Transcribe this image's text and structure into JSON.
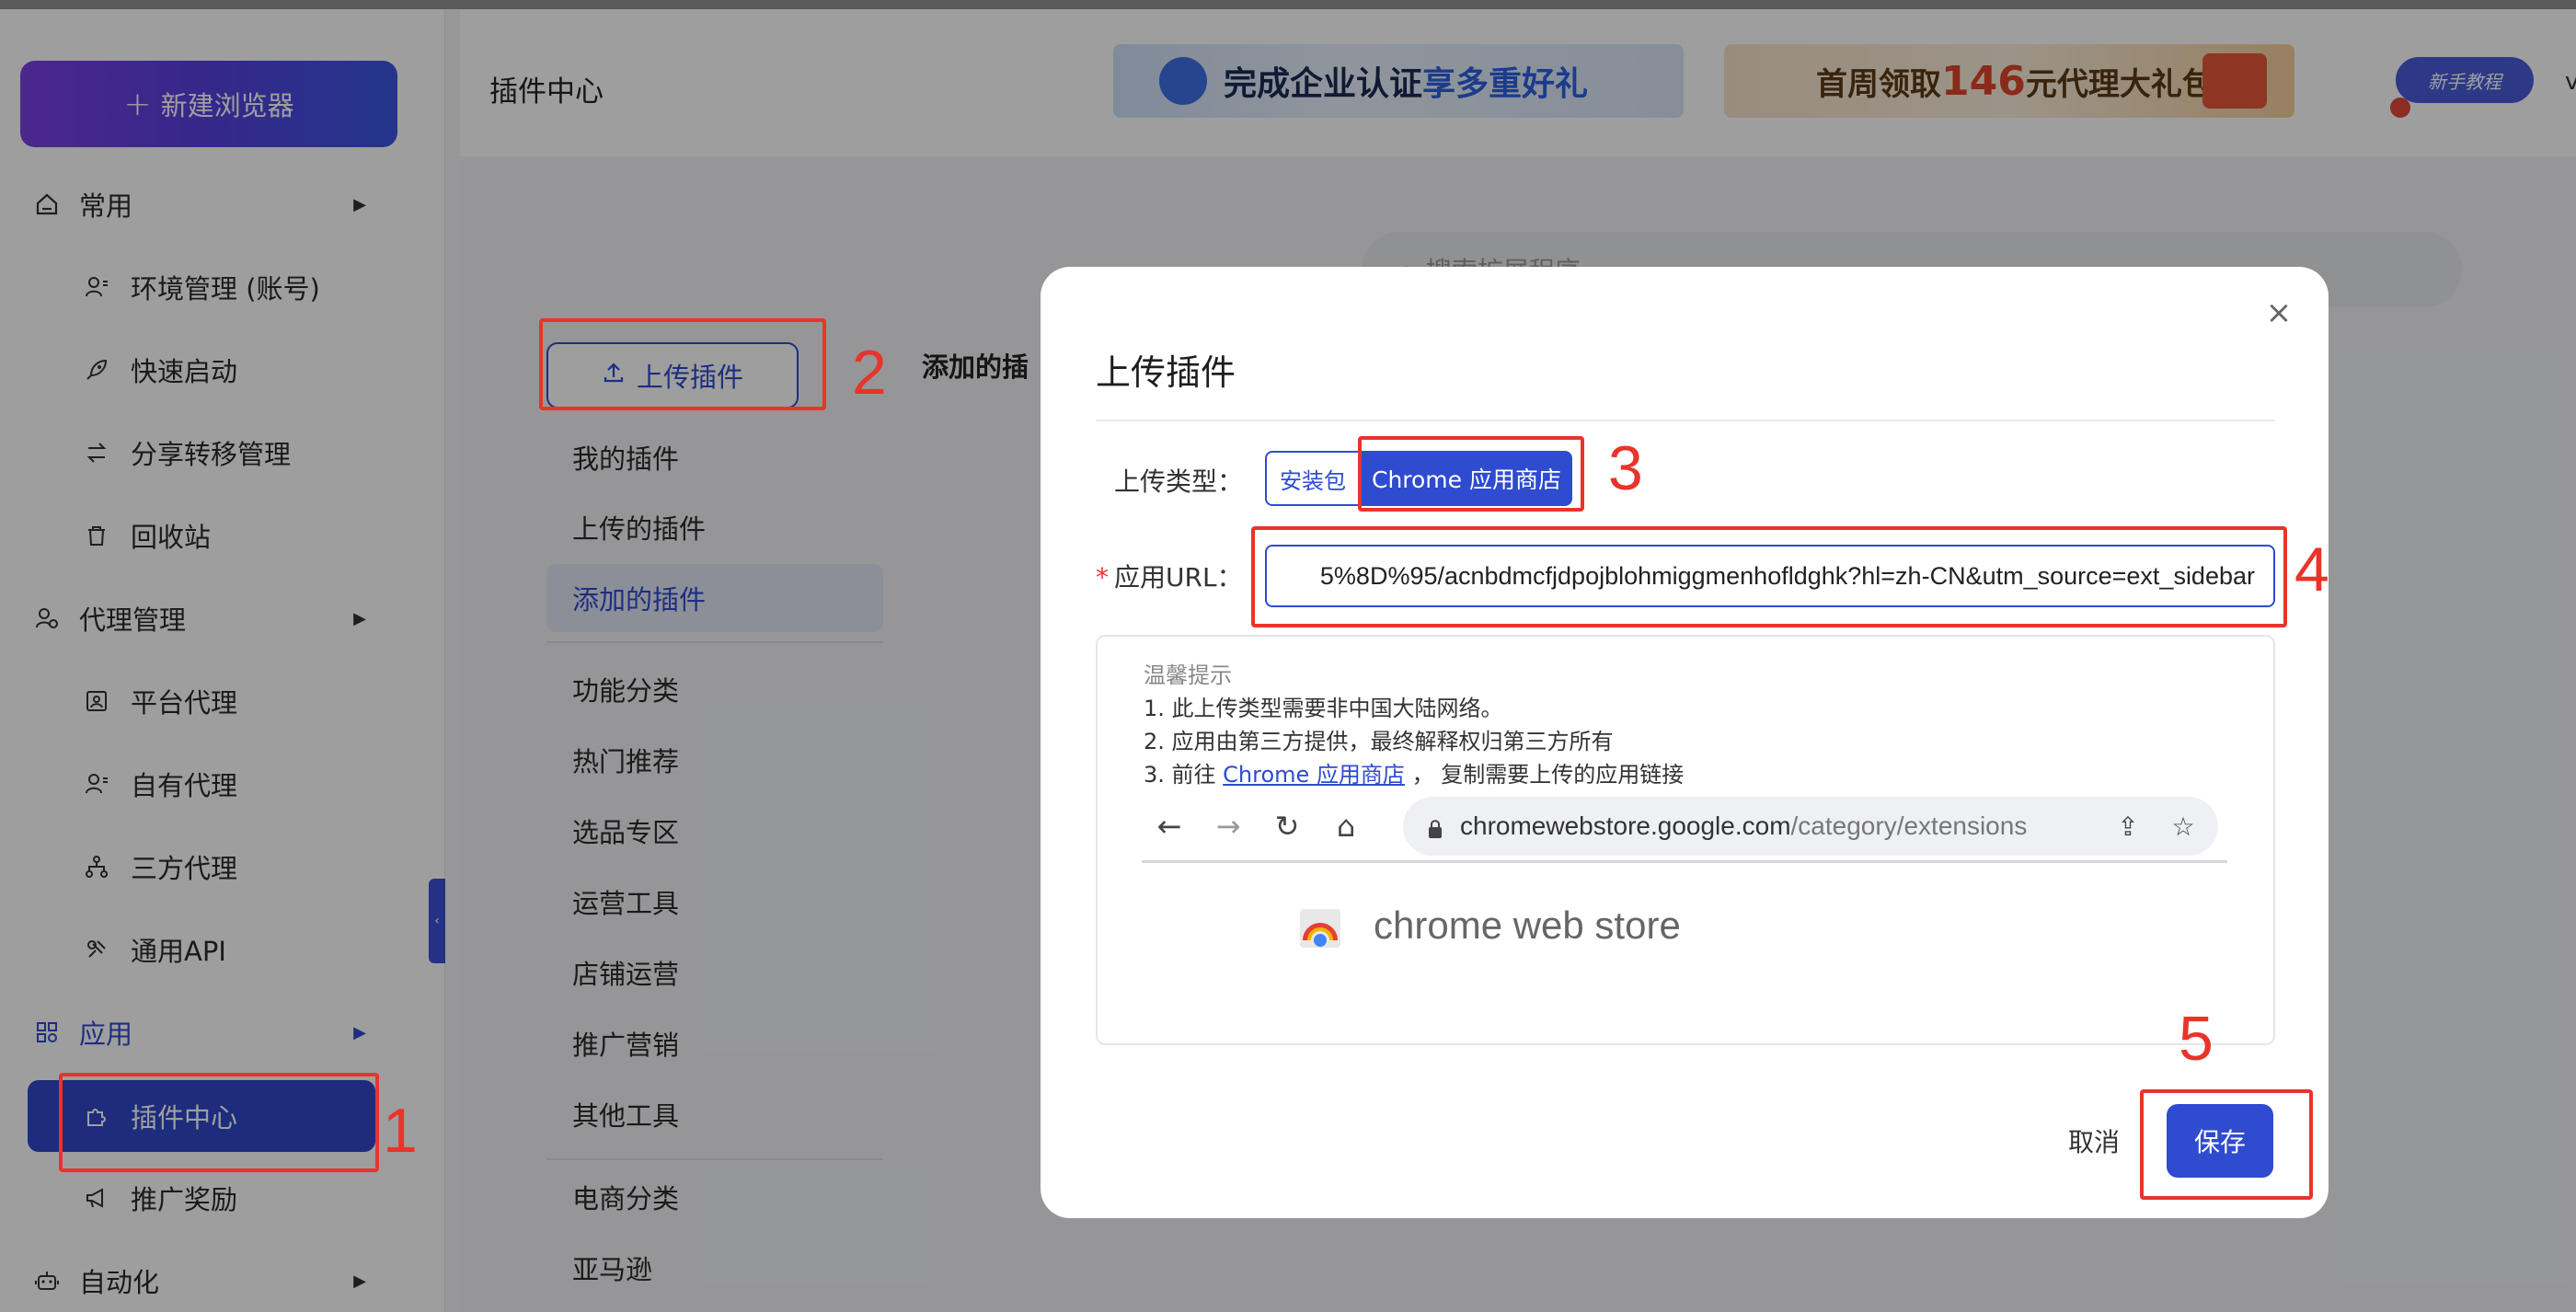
{
  "header": {
    "page_title": "插件中心",
    "banner1_text": "完成企业认证",
    "banner1_highlight": "享多重好礼",
    "banner2_text_a": "首周领取",
    "banner2_highlight": "146",
    "banner2_text_b": "元代理大礼包",
    "tutorial_label": "新手教程",
    "user_initial": "v"
  },
  "sidebar": {
    "new_browser_label": "新建浏览器",
    "groups": [
      {
        "label": "常用",
        "items": [
          "环境管理 (账号)",
          "快速启动",
          "分享转移管理",
          "回收站"
        ]
      },
      {
        "label": "代理管理",
        "items": [
          "平台代理",
          "自有代理",
          "三方代理",
          "通用API"
        ]
      },
      {
        "label": "应用",
        "items": [
          "插件中心",
          "推广奖励"
        ]
      },
      {
        "label": "自动化",
        "items": []
      }
    ],
    "active_item": "插件中心"
  },
  "plugin_nav": {
    "upload_label": "上传插件",
    "items": [
      "我的插件",
      "上传的插件",
      "添加的插件"
    ],
    "categories_title": "功能分类",
    "categories": [
      "热门推荐",
      "选品专区",
      "运营工具",
      "店铺运营",
      "推广营销",
      "其他工具"
    ],
    "ecommerce_title": "电商分类",
    "ecommerce": [
      "亚马逊"
    ],
    "section_title": "添加的插",
    "search_placeholder": "搜索扩展程序"
  },
  "modal": {
    "title": "上传插件",
    "upload_type_label": "上传类型：",
    "type_options": [
      "安装包",
      "Chrome 应用商店"
    ],
    "selected_type": "Chrome 应用商店",
    "url_label": "应用URL：",
    "url_value": "5%8D%95/acnbdmcfjdpojblohmiggmenhofldghk?hl=zh-CN&utm_source=ext_sidebar",
    "tips_title": "温馨提示",
    "tip1": "1. 此上传类型需要非中国大陆网络。",
    "tip2": "2. 应用由第三方提供，最终解释权归第三方所有",
    "tip3_prefix": "3. 前往",
    "tip3_link": "Chrome 应用商店",
    "tip3_suffix": "， 复制需要上传的应用链接",
    "browser_host": "chromewebstore.google.com",
    "browser_path": "/category/extensions",
    "store_name": "chrome web store",
    "cancel_label": "取消",
    "save_label": "保存"
  },
  "annotations": [
    "1",
    "2",
    "3",
    "4",
    "5"
  ],
  "colors": {
    "primary": "#2f4bd0",
    "annotation": "#e8342a",
    "active_bg": "#2f48c8"
  }
}
